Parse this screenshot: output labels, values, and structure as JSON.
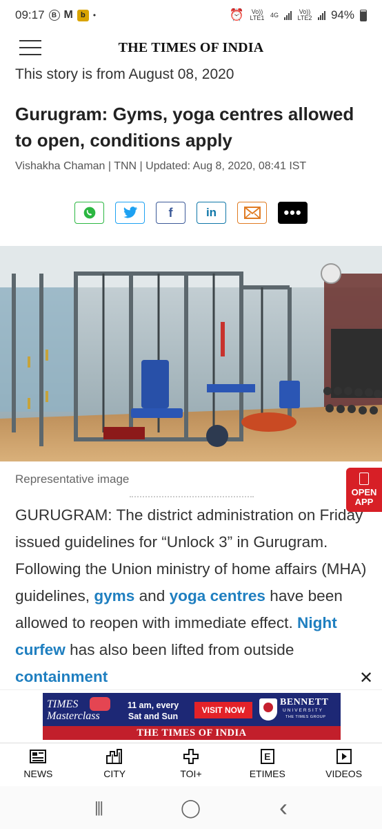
{
  "status_bar": {
    "time": "09:17",
    "icons": [
      "b-circle-icon",
      "gmail-icon",
      "b-square-icon"
    ],
    "dot": "•",
    "volte1": "Vo)) LTE1",
    "net": "4G",
    "volte2": "Vo)) LTE2",
    "battery": "94%"
  },
  "header": {
    "logo": "THE TIMES OF INDIA"
  },
  "article": {
    "date_note": "This story is from August 08, 2020",
    "headline": "Gurugram: Gyms, yoga centres allowed to open, conditions apply",
    "byline": "Vishakha Chaman | TNN | Updated: Aug 8, 2020, 08:41 IST",
    "image_caption": "Representative image",
    "body": {
      "p1": "GURUGRAM: The district administration on Friday issued guidelines for “Unlock 3” in Gurugram. Following the Union ministry of home affairs (MHA) guidelines, ",
      "link1": "gyms",
      "p2": " and ",
      "link2": "yoga centres",
      "p3": " have been allowed to reopen with immediate effect. ",
      "link3": "Night curfew",
      "p4": " has also been lifted from outside ",
      "link4": "containment"
    }
  },
  "share": {
    "buttons": [
      {
        "name": "whatsapp",
        "icon": "whatsapp-icon"
      },
      {
        "name": "twitter",
        "icon": "twitter-icon",
        "glyph": "🐦"
      },
      {
        "name": "facebook",
        "icon": "facebook-icon",
        "glyph": "f"
      },
      {
        "name": "linkedin",
        "icon": "linkedin-icon",
        "glyph": "in"
      },
      {
        "name": "email",
        "icon": "mail-icon"
      },
      {
        "name": "more",
        "icon": "more-icon",
        "glyph": "•••"
      }
    ]
  },
  "open_app": {
    "label_line1": "OPEN",
    "label_line2": "APP"
  },
  "ad": {
    "close": "✕",
    "brand": "TIMES Masterclass",
    "time_line1": "11 am, every",
    "time_line2": "Sat and Sun",
    "cta": "VISIT NOW",
    "uni": "BENNETT",
    "uni_sub": "UNIVERSITY",
    "uni_group": "THE TIMES GROUP",
    "footer": "THE TIMES OF INDIA"
  },
  "bottom_nav": {
    "items": [
      {
        "label": "NEWS",
        "icon": "news-icon"
      },
      {
        "label": "CITY",
        "icon": "city-icon"
      },
      {
        "label": "TOI+",
        "icon": "toi-plus-icon"
      },
      {
        "label": "ETIMES",
        "icon": "etimes-icon",
        "glyph": "E"
      },
      {
        "label": "VIDEOS",
        "icon": "videos-icon"
      }
    ]
  },
  "system_nav": {
    "recents": "|||",
    "home": "◯",
    "back": "‹"
  }
}
